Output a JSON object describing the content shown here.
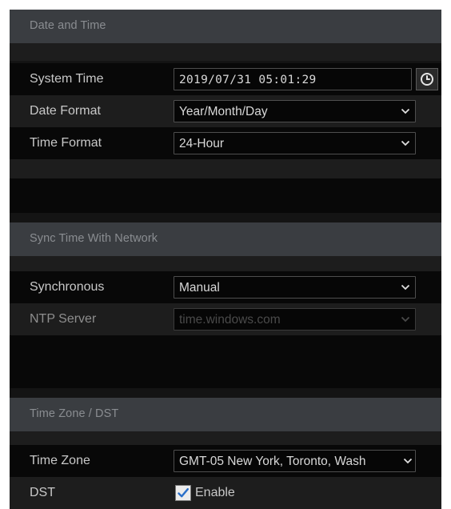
{
  "sections": {
    "date_time": {
      "title": "Date and Time"
    },
    "sync": {
      "title": "Sync Time With Network"
    },
    "timezone": {
      "title": "Time Zone / DST"
    }
  },
  "system_time": {
    "label": "System Time",
    "value": "2019/07/31 05:01:29",
    "icon": "clock-icon"
  },
  "date_format": {
    "label": "Date Format",
    "value": "Year/Month/Day"
  },
  "time_format": {
    "label": "Time Format",
    "value": "24-Hour"
  },
  "synchronous": {
    "label": "Synchronous",
    "value": "Manual"
  },
  "ntp_server": {
    "label": "NTP Server",
    "value": "time.windows.com",
    "disabled": true
  },
  "time_zone": {
    "label": "Time Zone",
    "value": "GMT-05 New York, Toronto, Wash"
  },
  "dst": {
    "label": "DST",
    "checkbox_label": "Enable",
    "checked": true
  },
  "colors": {
    "background": "#141414",
    "section_header": "#3a3d41",
    "row_dark": "#080808",
    "row_light": "#1d1d1d",
    "text": "#c8c8c8",
    "checkbox_accent": "#2a6fc9"
  }
}
